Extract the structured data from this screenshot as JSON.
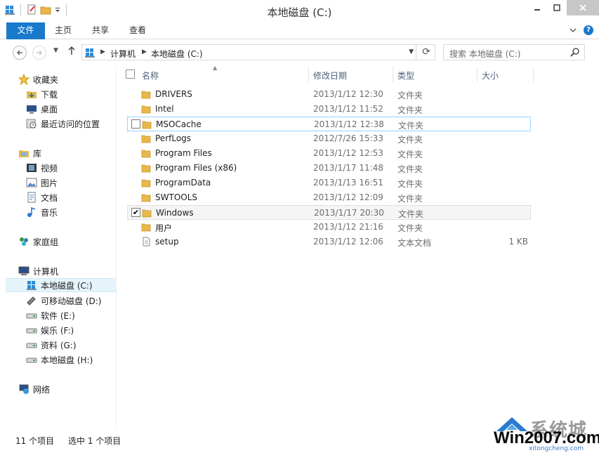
{
  "window": {
    "title": "本地磁盘 (C:)"
  },
  "ribbon": {
    "tabs": [
      "文件",
      "主页",
      "共享",
      "查看"
    ]
  },
  "address": {
    "segments": [
      "计算机",
      "本地磁盘 (C:)"
    ]
  },
  "search": {
    "placeholder": "搜索 本地磁盘 (C:)"
  },
  "sidebar": {
    "groups": [
      {
        "label": "收藏夹",
        "icon": "star-icon",
        "items": [
          {
            "label": "下载",
            "icon": "downloads-icon"
          },
          {
            "label": "桌面",
            "icon": "desktop-icon"
          },
          {
            "label": "最近访问的位置",
            "icon": "recent-places-icon"
          }
        ]
      },
      {
        "label": "库",
        "icon": "library-icon",
        "items": [
          {
            "label": "视频",
            "icon": "video-icon"
          },
          {
            "label": "图片",
            "icon": "picture-icon"
          },
          {
            "label": "文档",
            "icon": "document-icon"
          },
          {
            "label": "音乐",
            "icon": "music-icon"
          }
        ]
      },
      {
        "label": "家庭组",
        "icon": "homegroup-icon",
        "items": []
      },
      {
        "label": "计算机",
        "icon": "computer-icon",
        "items": [
          {
            "label": "本地磁盘 (C:)",
            "icon": "system-drive-icon",
            "selected": true
          },
          {
            "label": "可移动磁盘 (D:)",
            "icon": "removable-drive-icon"
          },
          {
            "label": "软件 (E:)",
            "icon": "drive-icon"
          },
          {
            "label": "娱乐 (F:)",
            "icon": "drive-icon"
          },
          {
            "label": "资料 (G:)",
            "icon": "drive-icon"
          },
          {
            "label": "本地磁盘 (H:)",
            "icon": "drive-icon"
          }
        ]
      },
      {
        "label": "网络",
        "icon": "network-icon",
        "items": []
      }
    ]
  },
  "columns": {
    "name": "名称",
    "date": "修改日期",
    "type": "类型",
    "size": "大小"
  },
  "files": [
    {
      "name": "DRIVERS",
      "date": "2013/1/12 12:30",
      "type": "文件夹",
      "size": "",
      "icon": "folder-icon"
    },
    {
      "name": "Intel",
      "date": "2013/1/12 11:52",
      "type": "文件夹",
      "size": "",
      "icon": "folder-icon"
    },
    {
      "name": "MSOCache",
      "date": "2013/1/12 12:38",
      "type": "文件夹",
      "size": "",
      "icon": "folder-icon",
      "hover": true
    },
    {
      "name": "PerfLogs",
      "date": "2012/7/26 15:33",
      "type": "文件夹",
      "size": "",
      "icon": "folder-icon"
    },
    {
      "name": "Program Files",
      "date": "2013/1/12 12:53",
      "type": "文件夹",
      "size": "",
      "icon": "folder-icon"
    },
    {
      "name": "Program Files (x86)",
      "date": "2013/1/17 11:48",
      "type": "文件夹",
      "size": "",
      "icon": "folder-icon"
    },
    {
      "name": "ProgramData",
      "date": "2013/1/13 16:51",
      "type": "文件夹",
      "size": "",
      "icon": "folder-icon"
    },
    {
      "name": "SWTOOLS",
      "date": "2013/1/12 12:09",
      "type": "文件夹",
      "size": "",
      "icon": "folder-icon"
    },
    {
      "name": "Windows",
      "date": "2013/1/17 20:30",
      "type": "文件夹",
      "size": "",
      "icon": "folder-icon",
      "checked": true
    },
    {
      "name": "用户",
      "date": "2013/1/12 21:16",
      "type": "文件夹",
      "size": "",
      "icon": "folder-icon"
    },
    {
      "name": "setup",
      "date": "2013/1/12 12:06",
      "type": "文本文档",
      "size": "1 KB",
      "icon": "text-file-icon"
    }
  ],
  "status": {
    "count": "11 个项目",
    "selection": "选中 1 个项目"
  },
  "watermark": {
    "cn": "系统城",
    "en": "Win2007.com",
    "domain": "xitongcheng.com"
  },
  "colors": {
    "accent": "#1979ca",
    "header_text": "#4c607a",
    "hover_border": "#99d1ff",
    "folder": "#e8b84a"
  }
}
